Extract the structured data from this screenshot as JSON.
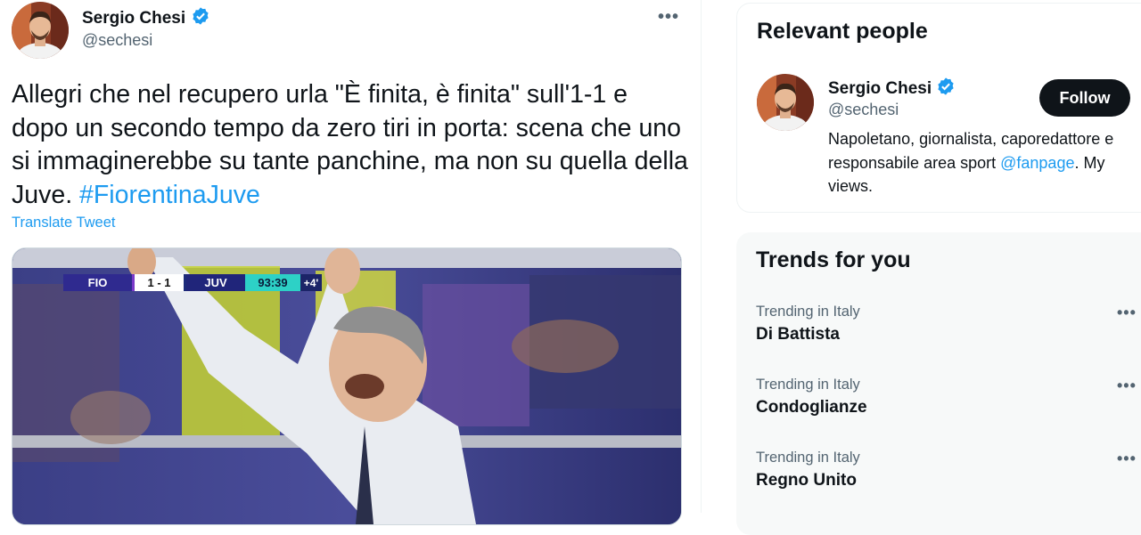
{
  "tweet": {
    "author_name": "Sergio Chesi",
    "author_handle": "@sechesi",
    "more_label": "•••",
    "text_main": "Allegri che nel recupero urla \"È finita, è finita\" sull'1-1 e dopo un secondo tempo da zero tiri in porta: scena che uno si immaginerebbe su tante panchine, ma non su quella della Juve. ",
    "hashtag": "#FiorentinaJuve",
    "translate_label": "Translate Tweet",
    "media": {
      "scoreboard": {
        "home": "FIO",
        "score": "1 - 1",
        "away": "JUV",
        "time": "93:39",
        "added": "+4'"
      }
    }
  },
  "relevant_people": {
    "title": "Relevant people",
    "person": {
      "name": "Sergio Chesi",
      "handle": "@sechesi",
      "bio_before": "Napoletano, giornalista, caporedattore e responsabile area sport ",
      "bio_mention": "@fanpage",
      "bio_after": ". My views.",
      "follow_label": "Follow"
    }
  },
  "trends": {
    "title": "Trends for you",
    "more_label": "•••",
    "items": [
      {
        "context": "Trending in Italy",
        "name": "Di Battista"
      },
      {
        "context": "Trending in Italy",
        "name": "Condoglianze"
      },
      {
        "context": "Trending in Italy",
        "name": "Regno Unito"
      }
    ]
  },
  "colors": {
    "accent": "#1d9bf0",
    "text_primary": "#0f1419",
    "text_secondary": "#536471",
    "verified": "#1d9bf0"
  },
  "icons": [
    "verified-badge-icon",
    "more-icon"
  ]
}
